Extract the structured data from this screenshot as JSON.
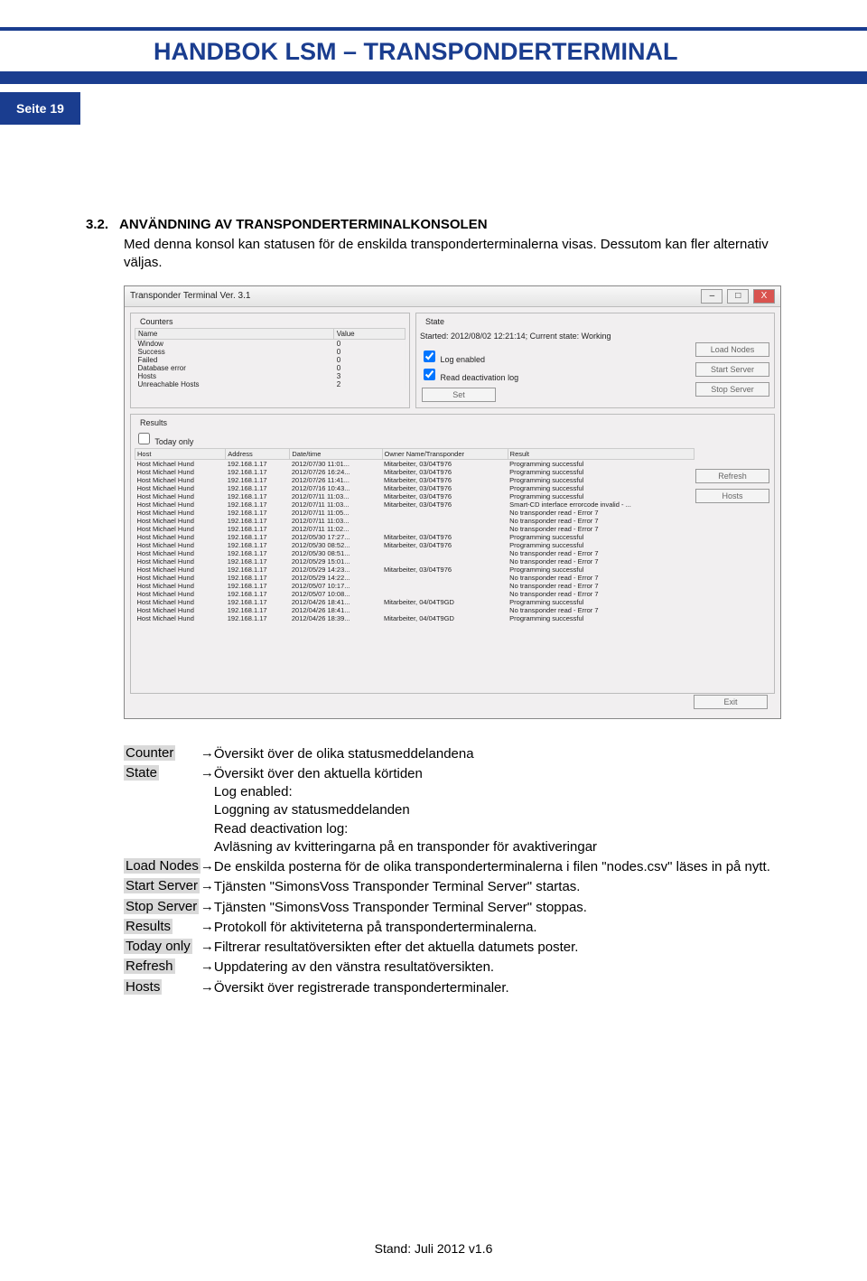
{
  "header": {
    "title": "HANDBOK LSM – TRANSPONDERTERMINAL",
    "page_label": "Seite 19"
  },
  "section": {
    "number": "3.2.",
    "title": "ANVÄNDNING AV TRANSPONDERTERMINALKONSOLEN",
    "text": "Med denna konsol kan statusen för de enskilda transponderterminalerna visas. Dessutom kan fler alternativ väljas."
  },
  "screenshot": {
    "window_title": "Transponder Terminal Ver. 3.1",
    "counters_label": "Counters",
    "state_label": "State",
    "state_text": "Started: 2012/08/02 12:21:14; Current state: Working",
    "log_enabled": "Log enabled",
    "read_deact": "Read deactivation log",
    "set_btn": "Set",
    "results_label": "Results",
    "today_only": "Today only",
    "btn_load": "Load Nodes",
    "btn_start": "Start Server",
    "btn_stop": "Stop Server",
    "btn_refresh": "Refresh",
    "btn_hosts": "Hosts",
    "btn_exit": "Exit",
    "counter_cols": [
      "Name",
      "Value"
    ],
    "counter_rows": [
      [
        "Window",
        "0"
      ],
      [
        "Success",
        "0"
      ],
      [
        "Failed",
        "0"
      ],
      [
        "Database error",
        "0"
      ],
      [
        "Hosts",
        "3"
      ],
      [
        "Unreachable Hosts",
        "2"
      ]
    ],
    "result_cols": [
      "Host",
      "Address",
      "Date/time",
      "Owner Name/Transponder",
      "Result"
    ],
    "result_rows": [
      [
        "Host Michael Hund",
        "192.168.1.17",
        "2012/07/30 11:01...",
        "Mitarbeiter, 03/04T976",
        "Programming successful"
      ],
      [
        "Host Michael Hund",
        "192.168.1.17",
        "2012/07/26 16:24...",
        "Mitarbeiter, 03/04T976",
        "Programming successful"
      ],
      [
        "Host Michael Hund",
        "192.168.1.17",
        "2012/07/26 11:41...",
        "Mitarbeiter, 03/04T976",
        "Programming successful"
      ],
      [
        "Host Michael Hund",
        "192.168.1.17",
        "2012/07/16 10:43...",
        "Mitarbeiter, 03/04T976",
        "Programming successful"
      ],
      [
        "Host Michael Hund",
        "192.168.1.17",
        "2012/07/11 11:03...",
        "Mitarbeiter, 03/04T976",
        "Programming successful"
      ],
      [
        "Host Michael Hund",
        "192.168.1.17",
        "2012/07/11 11:03...",
        "Mitarbeiter, 03/04T976",
        "Smart-CD interface errorcode invalid - ..."
      ],
      [
        "Host Michael Hund",
        "192.168.1.17",
        "2012/07/11 11:05...",
        "",
        "No transponder read - Error 7"
      ],
      [
        "Host Michael Hund",
        "192.168.1.17",
        "2012/07/11 11:03...",
        "",
        "No transponder read - Error 7"
      ],
      [
        "Host Michael Hund",
        "192.168.1.17",
        "2012/07/11 11:02...",
        "",
        "No transponder read - Error 7"
      ],
      [
        "Host Michael Hund",
        "192.168.1.17",
        "2012/05/30 17:27...",
        "Mitarbeiter, 03/04T976",
        "Programming successful"
      ],
      [
        "Host Michael Hund",
        "192.168.1.17",
        "2012/05/30 08:52...",
        "Mitarbeiter, 03/04T976",
        "Programming successful"
      ],
      [
        "Host Michael Hund",
        "192.168.1.17",
        "2012/05/30 08:51...",
        "",
        "No transponder read - Error 7"
      ],
      [
        "Host Michael Hund",
        "192.168.1.17",
        "2012/05/29 15:01...",
        "",
        "No transponder read - Error 7"
      ],
      [
        "Host Michael Hund",
        "192.168.1.17",
        "2012/05/29 14:23...",
        "Mitarbeiter, 03/04T976",
        "Programming successful"
      ],
      [
        "Host Michael Hund",
        "192.168.1.17",
        "2012/05/29 14:22...",
        "",
        "No transponder read - Error 7"
      ],
      [
        "Host Michael Hund",
        "192.168.1.17",
        "2012/05/07 10:17...",
        "",
        "No transponder read - Error 7"
      ],
      [
        "Host Michael Hund",
        "192.168.1.17",
        "2012/05/07 10:08...",
        "",
        "No transponder read - Error 7"
      ],
      [
        "Host Michael Hund",
        "192.168.1.17",
        "2012/04/26 18:41...",
        "Mitarbeiter, 04/04T9GD",
        "Programming successful"
      ],
      [
        "Host Michael Hund",
        "192.168.1.17",
        "2012/04/26 18:41...",
        "",
        "No transponder read - Error 7"
      ],
      [
        "Host Michael Hund",
        "192.168.1.17",
        "2012/04/26 18:39...",
        "Mitarbeiter, 04/04T9GD",
        "Programming successful"
      ]
    ]
  },
  "definitions": [
    {
      "label": "Counter",
      "desc": "Översikt över de olika statusmeddelandena"
    },
    {
      "label": "State",
      "desc": "Översikt över den aktuella körtiden\nLog enabled:\nLoggning av statusmeddelanden\nRead deactivation log:\nAvläsning av kvitteringarna på en transponder för avaktiveringar"
    },
    {
      "label": "Load Nodes",
      "desc": "De enskilda posterna för de olika transponderterminalerna i filen \"nodes.csv\" läses in på nytt."
    },
    {
      "label": "Start Server",
      "desc": "Tjänsten \"SimonsVoss Transponder Terminal Server\" startas."
    },
    {
      "label": "Stop Server",
      "desc": "Tjänsten \"SimonsVoss Transponder Terminal Server\" stoppas."
    },
    {
      "label": "Results",
      "desc": "Protokoll för aktiviteterna på transponderterminalerna."
    },
    {
      "label": "Today only",
      "desc": "Filtrerar resultatöversikten efter det aktuella datumets poster."
    },
    {
      "label": "Refresh",
      "desc": "Uppdatering av den vänstra resultatöversikten."
    },
    {
      "label": "Hosts",
      "desc": "Översikt över registrerade transponderterminaler."
    }
  ],
  "arrow": "→",
  "footer": "Stand: Juli 2012 v1.6"
}
